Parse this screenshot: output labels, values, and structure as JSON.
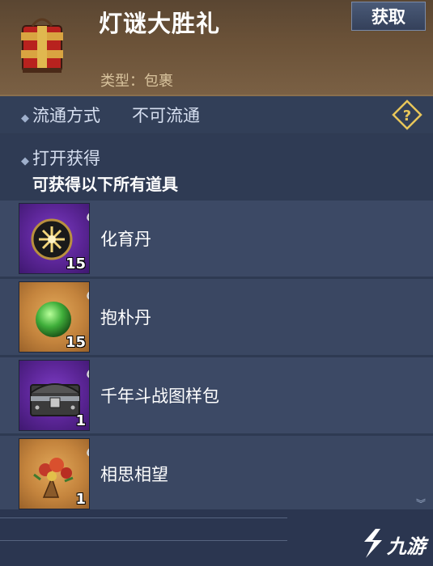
{
  "header": {
    "title": "灯谜大胜礼",
    "type_line": "类型：包裹",
    "get_button": "获取"
  },
  "circulation": {
    "label": "流通方式",
    "value": "不可流通"
  },
  "open_section": {
    "label": "打开获得",
    "description": "可获得以下所有道具"
  },
  "items": [
    {
      "name": "化育丹",
      "count": "15",
      "rarity": "purple"
    },
    {
      "name": "抱朴丹",
      "count": "15",
      "rarity": "orange"
    },
    {
      "name": "千年斗战图样包",
      "count": "1",
      "rarity": "purple"
    },
    {
      "name": "相思相望",
      "count": "1",
      "rarity": "orange"
    }
  ],
  "watermark": "九游",
  "colors": {
    "purple_rarity": "#6a2da8",
    "orange_rarity": "#c98a40",
    "help_icon": "#e8c65a"
  }
}
